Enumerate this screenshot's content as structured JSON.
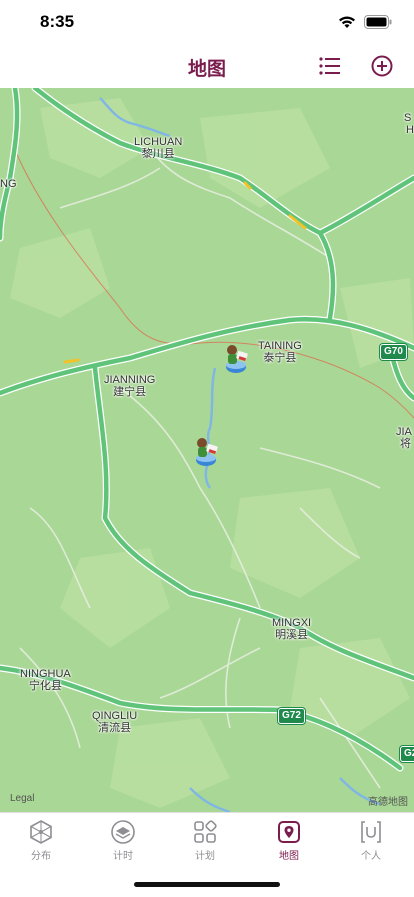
{
  "status": {
    "time": "8:35"
  },
  "nav": {
    "title": "地图",
    "list_icon": "list-icon",
    "add_icon": "add-circle-icon"
  },
  "map": {
    "cities": [
      {
        "en": "LICHUAN",
        "zh": "黎川县"
      },
      {
        "en": "TAINING",
        "zh": "泰宁县"
      },
      {
        "en": "JIANNING",
        "zh": "建宁县"
      },
      {
        "en": "MINGXI",
        "zh": "明溪县"
      },
      {
        "en": "NINGHUA",
        "zh": "宁化县"
      },
      {
        "en": "QINGLIU",
        "zh": "清流县"
      }
    ],
    "edge_labels": [
      {
        "text": "S"
      },
      {
        "text": "H"
      },
      {
        "text": "NG"
      },
      {
        "text": "JIA"
      },
      {
        "text": "将"
      }
    ],
    "highways": [
      "G70",
      "G72",
      "G2"
    ],
    "legal": "Legal",
    "attribution": "高德地图",
    "markers": [
      {
        "name": "camp-marker-1"
      },
      {
        "name": "camp-marker-2"
      }
    ],
    "colors": {
      "land": "#a9d795",
      "highway": "#5fc47a",
      "river": "#7fb6e6"
    }
  },
  "tabs": [
    {
      "label": "分布",
      "icon": "hexagon-network-icon",
      "active": false
    },
    {
      "label": "计时",
      "icon": "timer-stack-icon",
      "active": false
    },
    {
      "label": "计划",
      "icon": "grid-plan-icon",
      "active": false
    },
    {
      "label": "地图",
      "icon": "map-pin-icon",
      "active": true
    },
    {
      "label": "个人",
      "icon": "user-profile-icon",
      "active": false
    }
  ],
  "theme": {
    "accent": "#7a1d4e",
    "inactive": "#8e8e93"
  }
}
